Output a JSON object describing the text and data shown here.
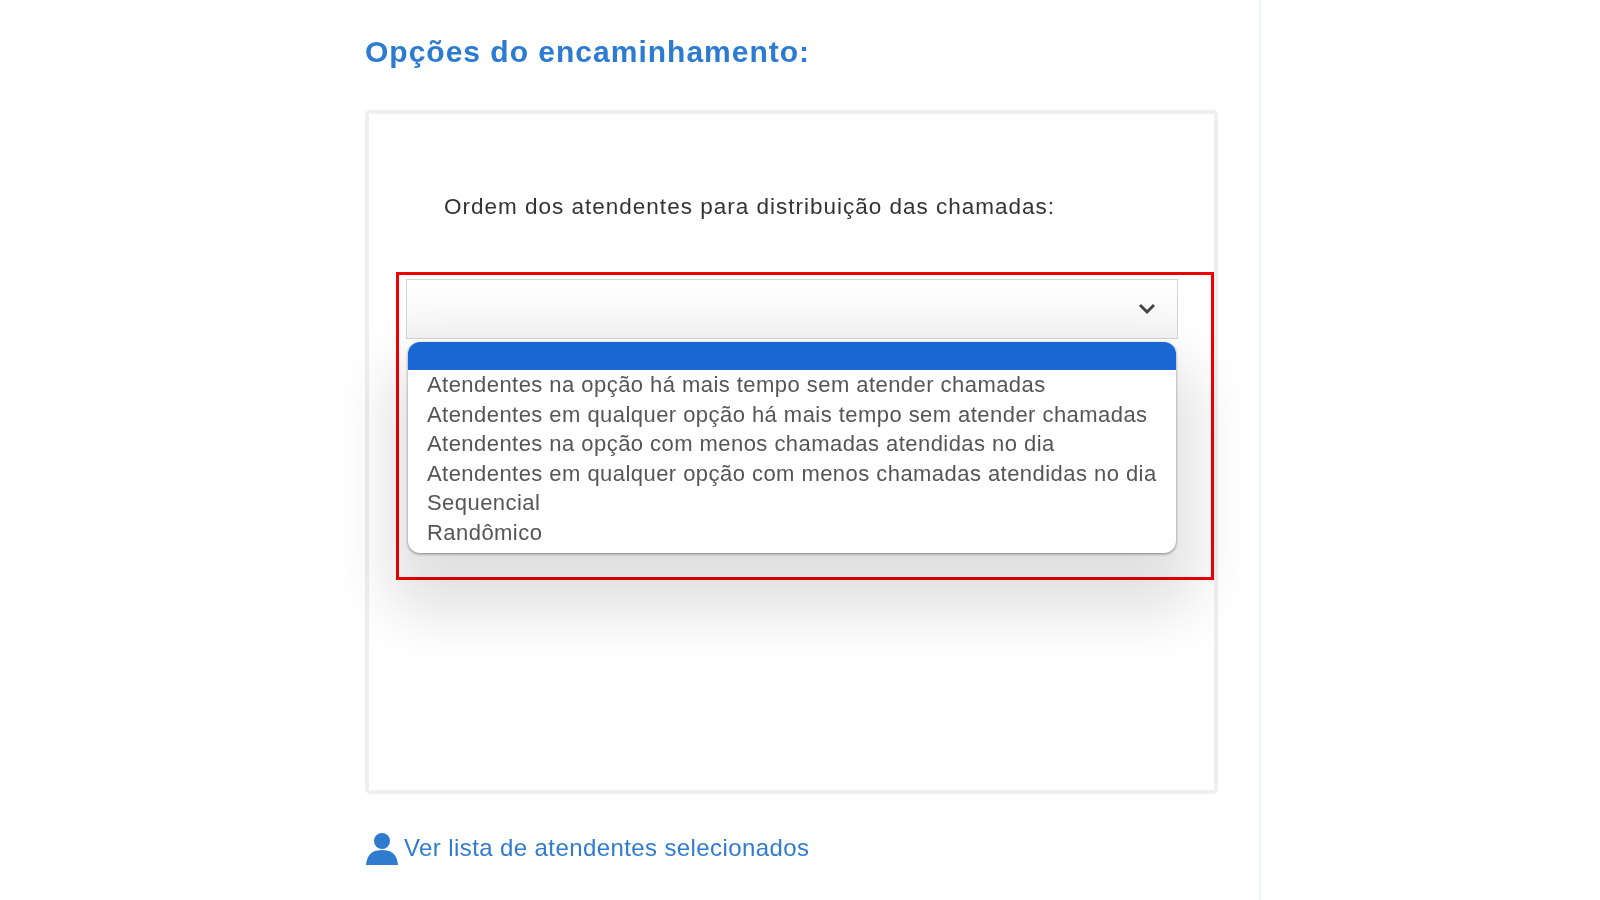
{
  "heading": "Opções do encaminhamento:",
  "field_label": "Ordem dos atendentes para distribuição das chamadas:",
  "select": {
    "expanded": true,
    "highlighted": true,
    "options": [
      {
        "selected": true
      },
      {
        "label": "Atendentes na opção há mais tempo sem atender chamadas",
        "selected": false
      },
      {
        "label": "Atendentes em qualquer opção há mais tempo sem atender chamadas",
        "selected": false
      },
      {
        "label": "Atendentes na opção com menos chamadas atendidas no dia",
        "selected": false
      },
      {
        "label": "Atendentes em qualquer opção com menos chamadas atendidas no dia",
        "selected": false
      },
      {
        "label": "Sequencial",
        "selected": false
      },
      {
        "label": "Randômico",
        "selected": false
      }
    ]
  },
  "link": "Ver lista de atendentes selecionados"
}
